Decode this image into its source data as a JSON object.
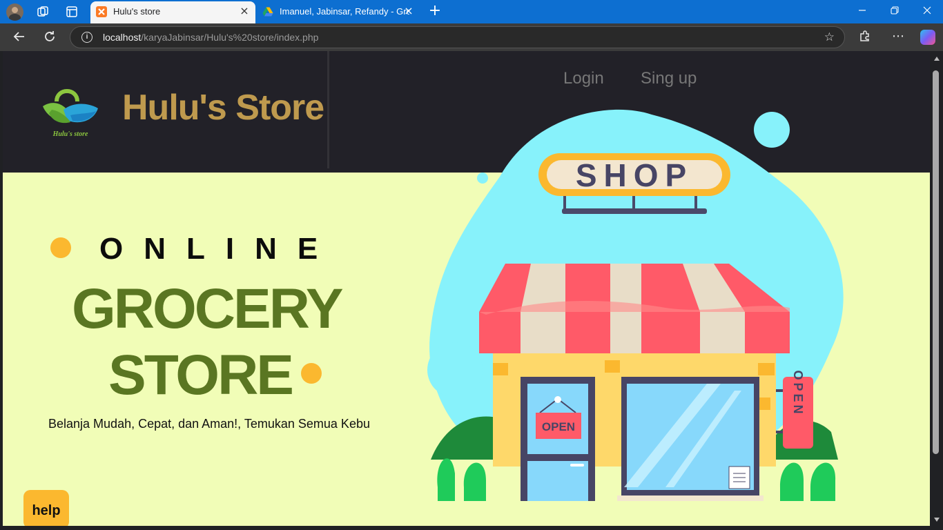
{
  "browser": {
    "tabs": [
      {
        "title": "Hulu's store",
        "active": true,
        "icon": "xampp-icon"
      },
      {
        "title": "Imanuel, Jabinsar, Refandy - Grosir",
        "active": false,
        "icon": "google-drive-icon"
      }
    ],
    "new_tab_label": "+",
    "url": {
      "host": "localhost",
      "path": "/karyaJabinsar/Hulu's%20store/index.php"
    },
    "icons": [
      "profile-avatar",
      "workspaces-icon",
      "tab-actions-icon",
      "back-icon",
      "refresh-icon",
      "site-info-icon",
      "favorite-star-icon",
      "extensions-icon",
      "more-icon",
      "copilot-icon",
      "minimize-icon",
      "restore-icon",
      "close-icon"
    ]
  },
  "header": {
    "logo_text": "Hulu's store",
    "brand": "Hulu's Store",
    "nav": {
      "login": "Login",
      "signup": "Sing up"
    }
  },
  "hero": {
    "online": "ONLINE",
    "line1": "GROCERY",
    "line2": "STORE",
    "tagline": "Belanja Mudah, Cepat, dan Aman!, Temukan Semua Kebu",
    "illustration": {
      "sign": "SHOP",
      "door_sign": "OPEN",
      "side_sign": "OPEN"
    }
  },
  "help_button": "help",
  "colors": {
    "header_bg": "#222128",
    "page_bg": "#f1fdb7",
    "brand": "#bf9a4e",
    "grocery_green": "#5a7622",
    "accent_yellow": "#fbb82f",
    "blob": "#87f2fb"
  }
}
